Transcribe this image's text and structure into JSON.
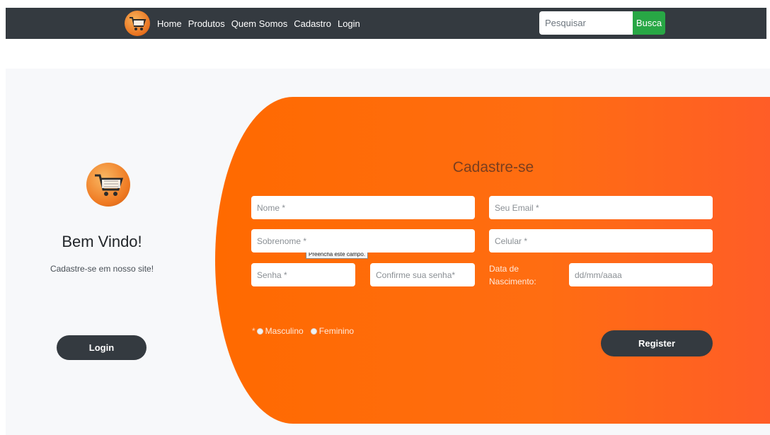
{
  "navbar": {
    "logo_icon": "cart-logo-icon",
    "links": [
      "Home",
      "Produtos",
      "Quem Somos",
      "Cadastro",
      "Login"
    ],
    "search_placeholder": "Pesquisar",
    "search_button": "Busca"
  },
  "welcome": {
    "logo_icon": "cart-logo-icon",
    "title": "Bem Vindo!",
    "subtitle": "Cadastre-se em nosso site!",
    "login_button": "Login"
  },
  "form": {
    "title": "Cadastre-se",
    "nome_placeholder": "Nome *",
    "email_placeholder": "Seu Email *",
    "sobrenome_placeholder": "Sobrenome *",
    "celular_placeholder": "Celular *",
    "senha_placeholder": "Senha *",
    "confirme_placeholder": "Confirme sua senha*",
    "dob_label": "Data de Nascimento:",
    "dob_placeholder": "dd/mm/aaaa",
    "tooltip": "Preencha este campo.",
    "gender_required": "*",
    "gender_options": [
      "Masculino",
      "Feminino"
    ],
    "register_button": "Register"
  },
  "colors": {
    "navbar": "#343a40",
    "accent_orange": "#ff6a00",
    "search_button": "#28a745",
    "dark_button": "#343a40"
  }
}
